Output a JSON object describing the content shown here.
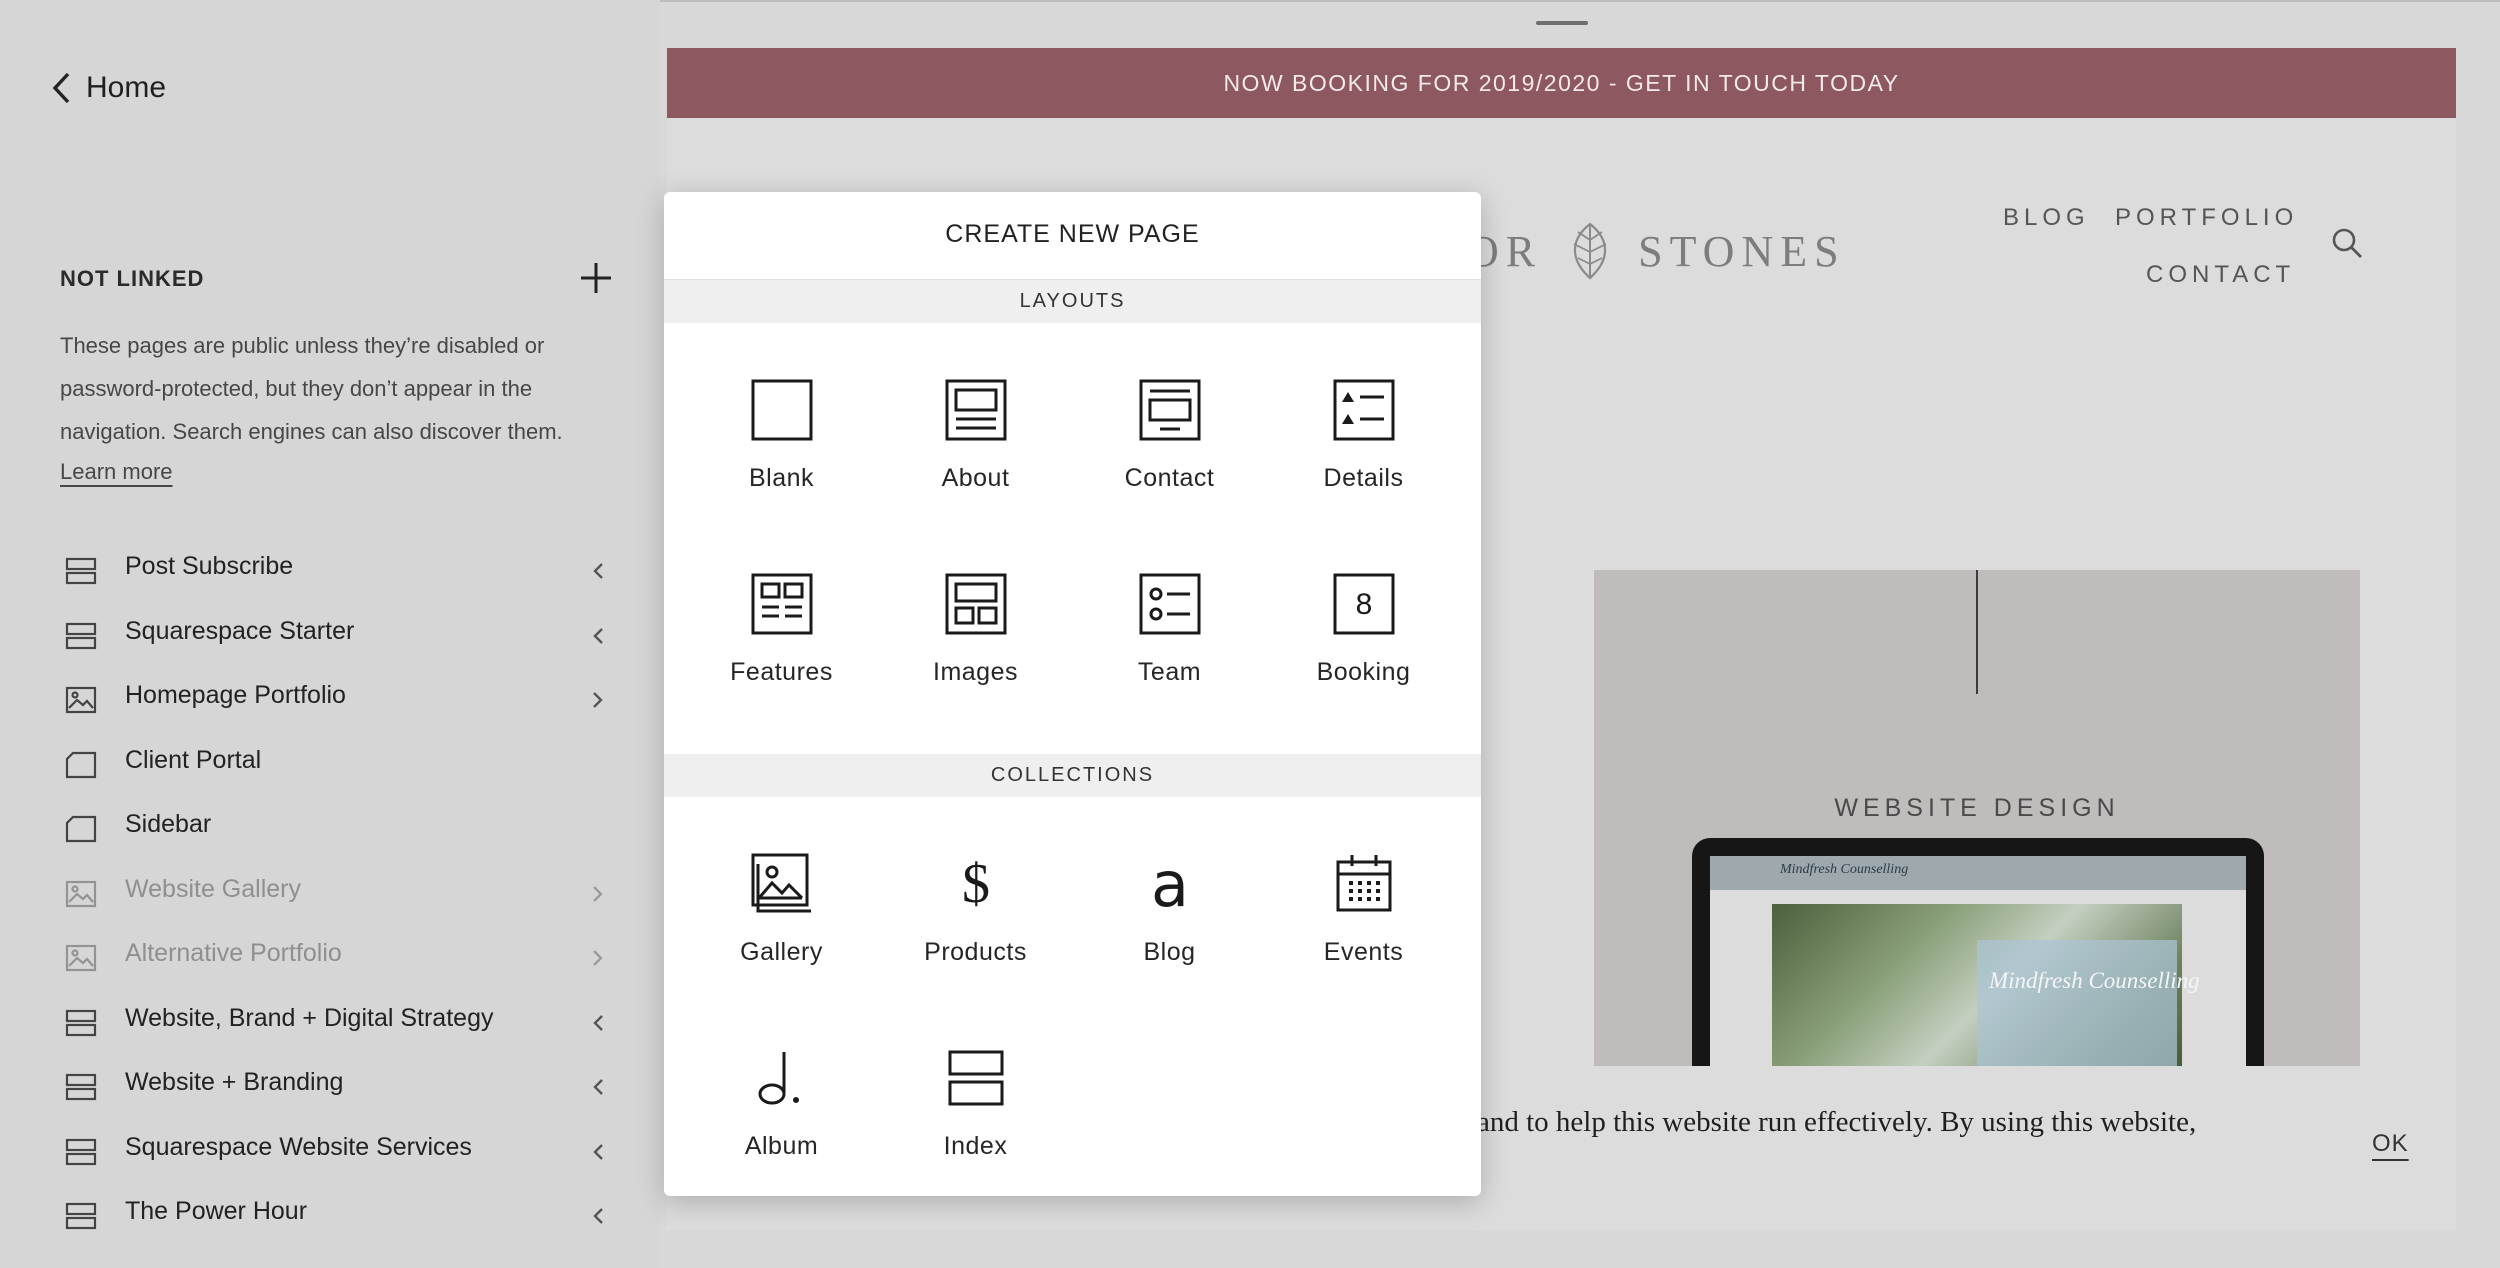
{
  "sidebar": {
    "back_label": "Home",
    "section_title": "NOT LINKED",
    "description": "These pages are public unless they’re disabled or password-protected, but they don’t appear in the navigation. Search engines can also discover them.",
    "learn_more": "Learn more",
    "pages": [
      {
        "label": "Post Subscribe",
        "icon": "index-page-icon",
        "arrow": "left",
        "disabled": false
      },
      {
        "label": "Squarespace Starter",
        "icon": "index-page-icon",
        "arrow": "left",
        "disabled": false
      },
      {
        "label": "Homepage Portfolio",
        "icon": "gallery-page-icon",
        "arrow": "right",
        "disabled": false
      },
      {
        "label": "Client Portal",
        "icon": "regular-page-icon",
        "arrow": "",
        "disabled": false
      },
      {
        "label": "Sidebar",
        "icon": "regular-page-icon",
        "arrow": "",
        "disabled": false
      },
      {
        "label": "Website Gallery",
        "icon": "gallery-page-icon",
        "arrow": "right",
        "disabled": true
      },
      {
        "label": "Alternative Portfolio",
        "icon": "gallery-page-icon",
        "arrow": "right",
        "disabled": true
      },
      {
        "label": "Website, Brand + Digital Strategy",
        "icon": "index-page-icon",
        "arrow": "left",
        "disabled": false
      },
      {
        "label": "Website + Branding",
        "icon": "index-page-icon",
        "arrow": "left",
        "disabled": false
      },
      {
        "label": "Squarespace Website Services",
        "icon": "index-page-icon",
        "arrow": "left",
        "disabled": false
      },
      {
        "label": "The Power Hour",
        "icon": "index-page-icon",
        "arrow": "left",
        "disabled": false
      }
    ]
  },
  "preview": {
    "banner": "NOW BOOKING FOR 2019/2020 - GET IN TOUCH TODAY",
    "logo_left": "OR",
    "logo_right": "STONES",
    "nav": [
      "BLOG",
      "PORTFOLIO",
      "CONTACT"
    ],
    "card_title": "WEBSITE DESIGN",
    "screen_brand": "Mindfresh Counselling",
    "screen_headline": "Mindfresh Counselling",
    "cookie_text": "and to help this website run effectively. By using this website,",
    "cookie_ok": "OK"
  },
  "modal": {
    "title": "CREATE NEW PAGE",
    "layouts_header": "LAYOUTS",
    "layouts": [
      {
        "label": "Blank",
        "icon": "blank-layout-icon"
      },
      {
        "label": "About",
        "icon": "about-layout-icon"
      },
      {
        "label": "Contact",
        "icon": "contact-layout-icon"
      },
      {
        "label": "Details",
        "icon": "details-layout-icon"
      },
      {
        "label": "Features",
        "icon": "features-layout-icon"
      },
      {
        "label": "Images",
        "icon": "images-layout-icon"
      },
      {
        "label": "Team",
        "icon": "team-layout-icon"
      },
      {
        "label": "Booking",
        "icon": "booking-layout-icon"
      }
    ],
    "collections_header": "COLLECTIONS",
    "collections": [
      {
        "label": "Gallery",
        "icon": "gallery-collection-icon"
      },
      {
        "label": "Products",
        "icon": "products-collection-icon"
      },
      {
        "label": "Blog",
        "icon": "blog-collection-icon"
      },
      {
        "label": "Events",
        "icon": "events-collection-icon"
      },
      {
        "label": "Album",
        "icon": "album-collection-icon"
      },
      {
        "label": "Index",
        "icon": "index-collection-icon"
      }
    ],
    "booking_glyph": "8",
    "products_glyph": "$",
    "blog_glyph": "a"
  },
  "colors": {
    "banner": "#8e5860",
    "background": "#d8d8d8",
    "modal": "#ffffff"
  }
}
